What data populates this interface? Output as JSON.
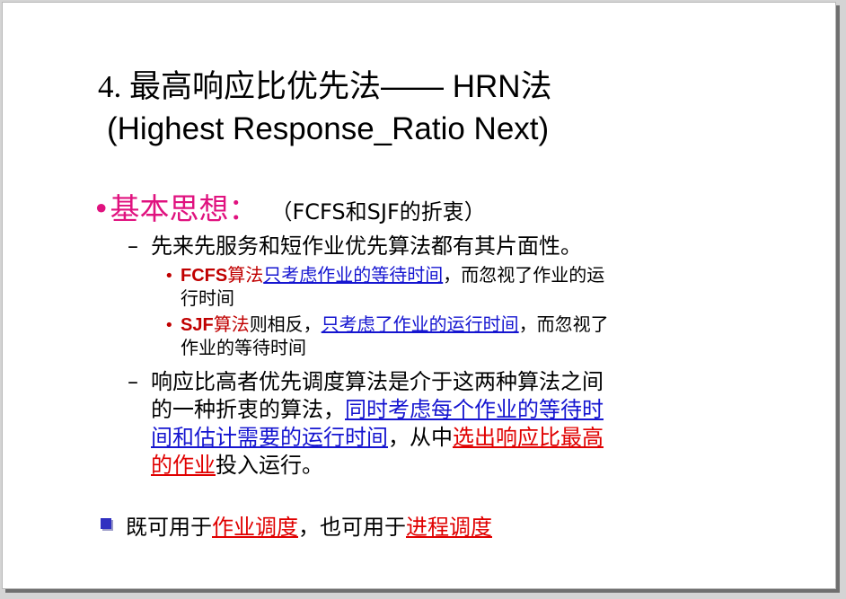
{
  "title": {
    "line1_num": "4. ",
    "line1_text": "最高响应比优先法—— HRN法",
    "line2": "(Highest Response_Ratio Next)"
  },
  "heading": {
    "bullet": "•",
    "label": "基本思想：",
    "aside": "（FCFS和SJF的折衷）"
  },
  "point1": {
    "dash": "–",
    "text": "先来先服务和短作业优先算法都有其片面性。"
  },
  "sub1": {
    "dot": "•",
    "algo": "FCFS",
    "algo_suffix": "算法",
    "link": "只考虑作业的等待时间",
    "text_a": "，而忽视了作业的运",
    "text_b": "行时间"
  },
  "sub2": {
    "dot": "•",
    "algo": "SJF",
    "algo_suffix": "算法",
    "pre": "则相反，",
    "link": "只考虑了作业的运行时间",
    "text_a": "，而忽视了",
    "text_b": "作业的等待时间"
  },
  "point2": {
    "dash": "–",
    "line1": "响应比高者优先调度算法是介于这两种算法之间",
    "line2_pre": "的一种折衷的算法，",
    "link_part1": "同时考虑每个作业的等待时",
    "link_part2": "间和估计需要的运行时间",
    "line3_mid": "，从中",
    "red_part1": "选出响应比最高",
    "red_part2": "的作业",
    "line4_post": "投入运行。"
  },
  "final": {
    "pre": "既可用于",
    "link1": "作业调度",
    "mid": "，也可用于",
    "link2": "进程调度"
  },
  "colors": {
    "heading": "#e0127f",
    "algo": "#c00000",
    "blue_link": "#1515d0",
    "red_link": "#e00000",
    "square_bullet": "#3030c0"
  },
  "icons": {
    "final_bullet": "square-bullet-icon"
  }
}
